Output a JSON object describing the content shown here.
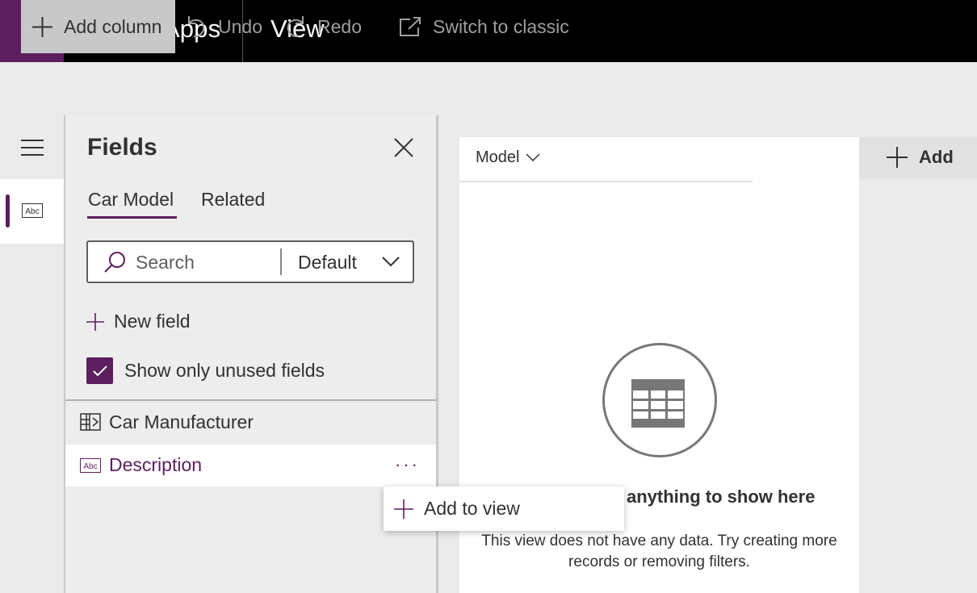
{
  "header": {
    "app_name": "PowerApps",
    "page_title": "View",
    "waffle_icon": "waffle-icon",
    "brand_color": "#5c1f5e"
  },
  "commandbar": {
    "add_column": "Add column",
    "undo": "Undo",
    "redo": "Redo",
    "switch_classic": "Switch to classic"
  },
  "rail": {
    "items": [
      {
        "icon": "hamburger-icon"
      },
      {
        "icon": "text-field-icon",
        "label": "Abc",
        "selected": true
      }
    ]
  },
  "fields_panel": {
    "title": "Fields",
    "tabs": [
      {
        "label": "Car Model",
        "selected": true
      },
      {
        "label": "Related",
        "selected": false
      }
    ],
    "search_placeholder": "Search",
    "filter_value": "Default",
    "new_field": "New field",
    "show_unused_label": "Show only unused fields",
    "show_unused_checked": true,
    "fields": [
      {
        "label": "Car Manufacturer",
        "icon": "lookup-icon"
      },
      {
        "label": "Description",
        "icon": "text-field-icon",
        "hovered": true
      }
    ],
    "more_label": "···",
    "context_menu": {
      "add_to_view": "Add to view"
    }
  },
  "view_canvas": {
    "columns": [
      {
        "label": "Model"
      }
    ],
    "add_column": "Add",
    "empty_title": "anything to show here",
    "empty_message": "This view does not have any data. Try creating more records or removing filters."
  }
}
